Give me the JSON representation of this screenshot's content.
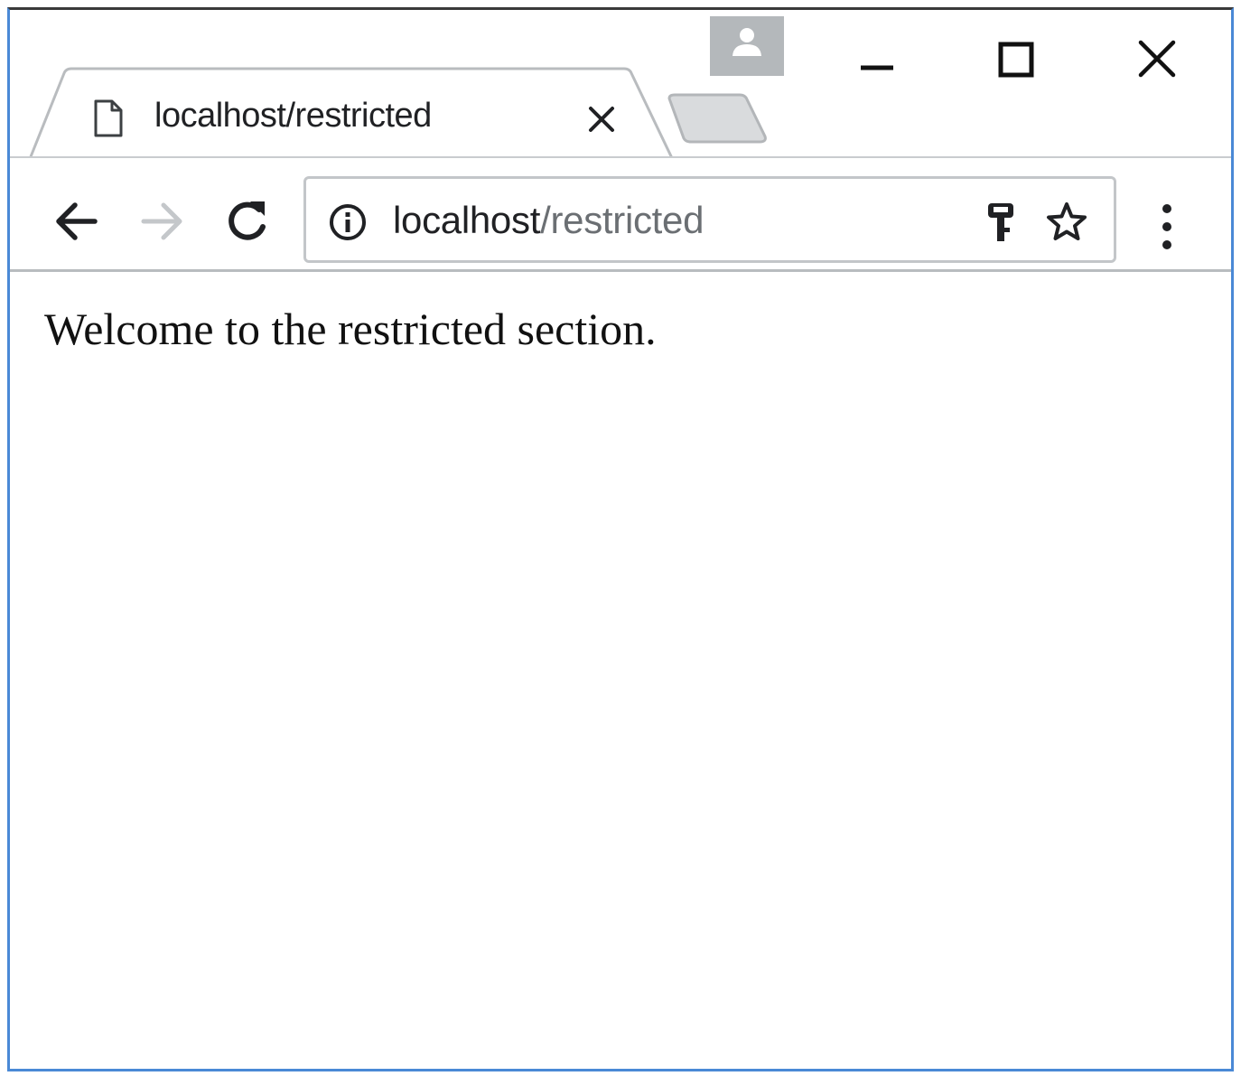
{
  "tab": {
    "title": "localhost/restricted"
  },
  "address_bar": {
    "host": "localhost",
    "path": "/restricted"
  },
  "page": {
    "body_text": "Welcome to the restricted section."
  },
  "icons": {
    "favicon": "page-icon",
    "tab_close": "close-icon",
    "new_tab": "new-tab-icon",
    "profile": "person-icon",
    "minimize": "minimize-icon",
    "maximize": "maximize-icon",
    "window_close": "close-icon",
    "back": "arrow-left-icon",
    "forward": "arrow-right-icon",
    "reload": "reload-icon",
    "site_info": "info-icon",
    "saved_password": "key-icon",
    "bookmark": "star-icon",
    "menu": "vertical-dots-icon"
  },
  "colors": {
    "window_border": "#4a89d6",
    "url_host": "#202124",
    "url_path": "#6b6f73",
    "forward_disabled": "#c4c7ca"
  }
}
